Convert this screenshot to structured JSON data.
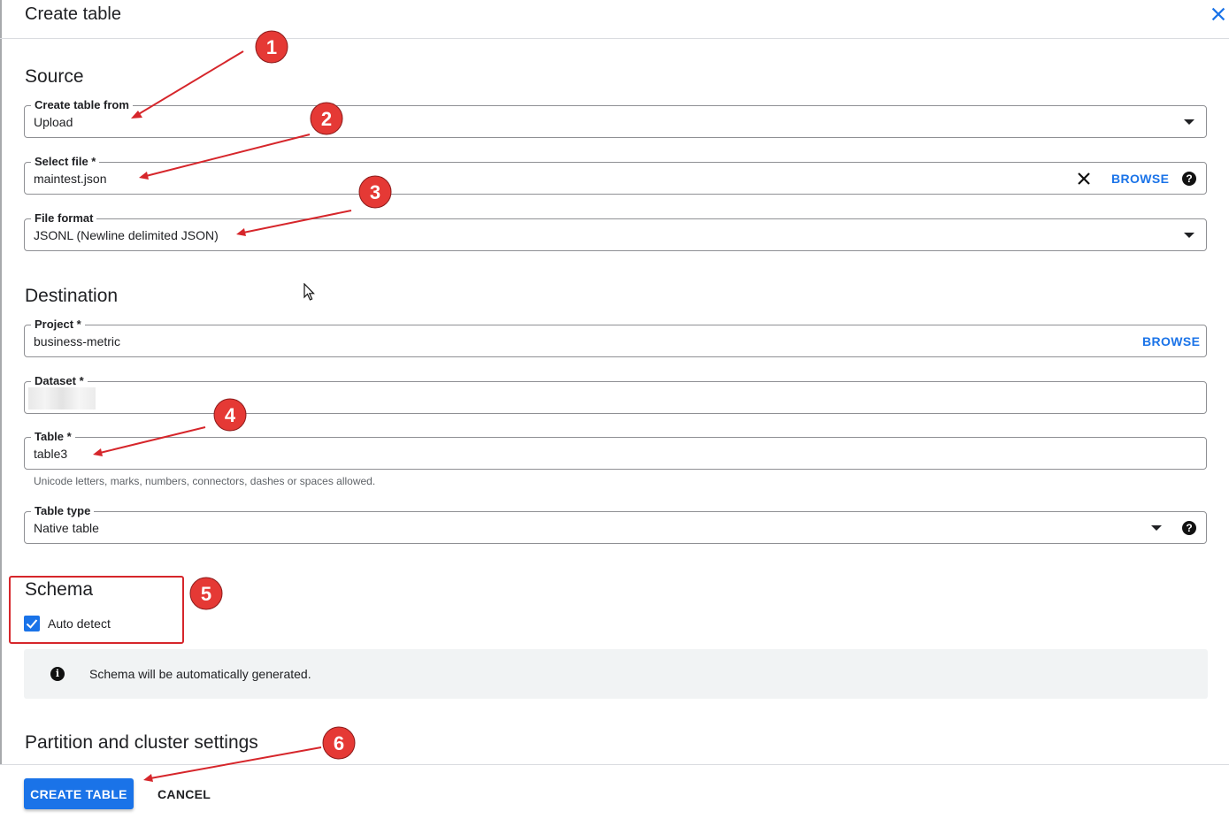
{
  "header": {
    "title": "Create table"
  },
  "source": {
    "heading": "Source",
    "create_from": {
      "label": "Create table from",
      "value": "Upload"
    },
    "select_file": {
      "label": "Select file *",
      "value": "maintest.json",
      "browse": "BROWSE"
    },
    "file_format": {
      "label": "File format",
      "value": "JSONL (Newline delimited JSON)"
    }
  },
  "destination": {
    "heading": "Destination",
    "project": {
      "label": "Project *",
      "value": "business-metric",
      "browse": "BROWSE"
    },
    "dataset": {
      "label": "Dataset *",
      "value": ""
    },
    "table": {
      "label": "Table *",
      "value": "table3",
      "hint": "Unicode letters, marks, numbers, connectors, dashes or spaces allowed."
    },
    "table_type": {
      "label": "Table type",
      "value": "Native table"
    }
  },
  "schema": {
    "heading": "Schema",
    "auto_detect_label": "Auto detect",
    "auto_detect_checked": true,
    "info": "Schema will be automatically generated."
  },
  "partition": {
    "heading": "Partition and cluster settings"
  },
  "footer": {
    "create": "CREATE TABLE",
    "cancel": "CANCEL"
  },
  "annotations": {
    "color": "#d6262b",
    "markers": [
      "1",
      "2",
      "3",
      "4",
      "5",
      "6"
    ]
  },
  "icons": {
    "close": "close-icon",
    "dropdown": "caret-down-icon",
    "clear": "clear-icon",
    "help": "help-icon",
    "info": "info-icon",
    "check": "check-icon",
    "cursor": "mouse-pointer-icon"
  }
}
